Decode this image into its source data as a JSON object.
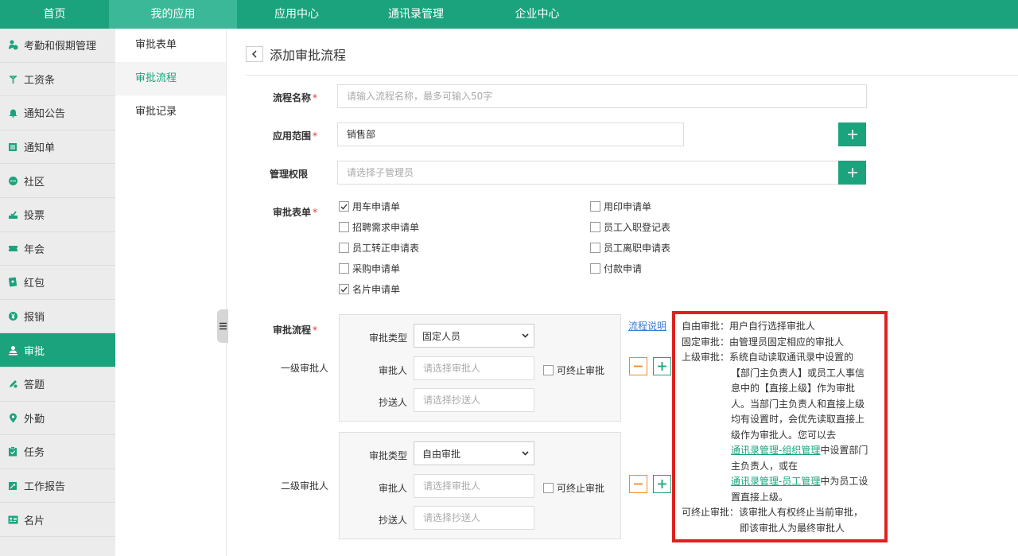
{
  "topnav": {
    "tabs": [
      {
        "label": "首页",
        "active": false
      },
      {
        "label": "我的应用",
        "active": true
      },
      {
        "label": "应用中心",
        "active": false
      },
      {
        "label": "通讯录管理",
        "active": false
      },
      {
        "label": "企业中心",
        "active": false
      }
    ]
  },
  "sidebar": {
    "items": [
      {
        "label": "考勤和假期管理",
        "icon": "person-clock-icon"
      },
      {
        "label": "工资条",
        "icon": "money-tree-icon"
      },
      {
        "label": "通知公告",
        "icon": "bell-icon"
      },
      {
        "label": "通知单",
        "icon": "notice-list-icon"
      },
      {
        "label": "社区",
        "icon": "chat-bubble-icon"
      },
      {
        "label": "投票",
        "icon": "vote-icon"
      },
      {
        "label": "年会",
        "icon": "ticket-icon"
      },
      {
        "label": "红包",
        "icon": "red-envelope-icon"
      },
      {
        "label": "报销",
        "icon": "yen-coin-icon"
      },
      {
        "label": "审批",
        "icon": "person-stamp-icon",
        "active": true
      },
      {
        "label": "答题",
        "icon": "pencil-icon"
      },
      {
        "label": "外勤",
        "icon": "location-pin-icon"
      },
      {
        "label": "任务",
        "icon": "clipboard-icon"
      },
      {
        "label": "工作报告",
        "icon": "report-icon"
      },
      {
        "label": "名片",
        "icon": "business-card-icon"
      }
    ]
  },
  "submenu": {
    "items": [
      {
        "label": "审批表单"
      },
      {
        "label": "审批流程",
        "active": true
      },
      {
        "label": "审批记录"
      }
    ]
  },
  "page": {
    "title": "添加审批流程",
    "form": {
      "name_label": "流程名称",
      "name_placeholder": "请输入流程名称，最多可输入50字",
      "scope_label": "应用范围",
      "scope_value": "销售部",
      "perm_label": "管理权限",
      "perm_placeholder": "请选择子管理员",
      "forms_label": "审批表单",
      "required_mark": "*",
      "forms": [
        {
          "label": "用车申请单",
          "checked": true
        },
        {
          "label": "用印申请单",
          "checked": false
        },
        {
          "label": "招聘需求申请单",
          "checked": false
        },
        {
          "label": "员工入职登记表",
          "checked": false
        },
        {
          "label": "员工转正申请表",
          "checked": false
        },
        {
          "label": "员工离职申请表",
          "checked": false
        },
        {
          "label": "采购申请单",
          "checked": false
        },
        {
          "label": "付款申请",
          "checked": false
        },
        {
          "label": "名片申请单",
          "checked": true
        }
      ],
      "flow_label": "审批流程",
      "flow_help_link": "流程说明",
      "levels": [
        {
          "level_label": "一级审批人",
          "type_label": "审批类型",
          "type_value": "固定人员",
          "approver_label": "审批人",
          "approver_placeholder": "请选择审批人",
          "terminate_label": "可终止审批",
          "cc_label": "抄送人",
          "cc_placeholder": "请选择抄送人"
        },
        {
          "level_label": "二级审批人",
          "type_label": "审批类型",
          "type_value": "自由审批",
          "approver_label": "审批人",
          "approver_placeholder": "请选择审批人",
          "terminate_label": "可终止审批",
          "cc_label": "抄送人",
          "cc_placeholder": "请选择抄送人"
        }
      ]
    },
    "help": {
      "free": "自由审批：用户自行选择审批人",
      "fixed": "固定审批：由管理员固定相应的审批人",
      "superior_l1": "上级审批：系统自动读取通讯录中设置的",
      "superior_l2": "【部门主负责人】或员工人事信",
      "superior_l3": "息中的【直接上级】作为审批",
      "superior_l4": "人。当部门主负责人和直接上级",
      "superior_l5": "均有设置时，会优先读取直接上",
      "superior_l6": "级作为审批人。您可以去",
      "link_org": "通讯录管理-组织管理",
      "after_org": "中设置部门",
      "superior_l8": "主负责人，或在",
      "link_staff": "通讯录管理-员工管理",
      "after_staff": "中为员工设",
      "superior_l10": "置直接上级。",
      "terminable_l1": "可终止审批：该审批人有权终止当前审批，",
      "terminable_l2": "即该审批人为最终审批人"
    }
  },
  "colors": {
    "primary": "#1aa37d",
    "accent_orange": "#f08a2d",
    "highlight_red": "#e02020",
    "link_blue": "#3a7bd5"
  }
}
